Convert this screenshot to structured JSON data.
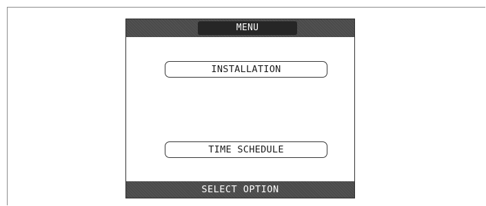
{
  "screen": {
    "title": "MENU",
    "status": "SELECT OPTION"
  },
  "menu": {
    "items": [
      {
        "label": "INSTALLATION"
      },
      {
        "label": "TIME SCHEDULE"
      }
    ]
  },
  "colors": {
    "bar_background": "#4a4a4a",
    "title_pill": "#262626",
    "border": "#2e2e2e",
    "text_light": "#ffffff",
    "text_dark": "#1a1a1a"
  }
}
